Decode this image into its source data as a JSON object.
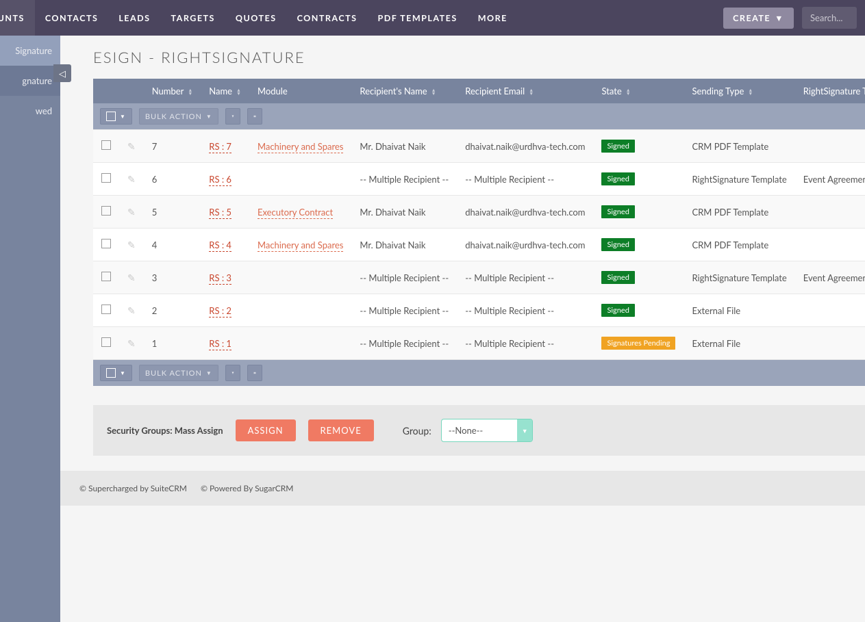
{
  "nav": {
    "items": [
      "OUNTS",
      "CONTACTS",
      "LEADS",
      "TARGETS",
      "QUOTES",
      "CONTRACTS",
      "PDF TEMPLATES",
      "MORE"
    ],
    "create": "CREATE",
    "search_placeholder": "Search..."
  },
  "sidebar": {
    "items": [
      "Signature",
      "gnature",
      "wed"
    ]
  },
  "collapse_glyph": "◁",
  "title": "ESIGN - RIGHTSIGNATURE",
  "columns": [
    "Number",
    "Name",
    "Module",
    "Recipient's Name",
    "Recipient Email",
    "State",
    "Sending Type",
    "RightSignature Templates"
  ],
  "bulk_label": "BULK ACTION",
  "rows": [
    {
      "number": "7",
      "name": "RS : 7",
      "module": "Machinery and Spares",
      "recipient": "Mr. Dhaivat Naik",
      "email": "dhaivat.naik@urdhva-tech.com",
      "state": "Signed",
      "state_cls": "green",
      "sending": "CRM PDF Template",
      "tmpl": ""
    },
    {
      "number": "6",
      "name": "RS : 6",
      "module": "",
      "recipient": "-- Multiple Recipient --",
      "email": "-- Multiple Recipient --",
      "state": "Signed",
      "state_cls": "green",
      "sending": "RightSignature Template",
      "tmpl": "Event Agreement"
    },
    {
      "number": "5",
      "name": "RS : 5",
      "module": "Executory Contract",
      "recipient": "Mr. Dhaivat Naik",
      "email": "dhaivat.naik@urdhva-tech.com",
      "state": "Signed",
      "state_cls": "green",
      "sending": "CRM PDF Template",
      "tmpl": ""
    },
    {
      "number": "4",
      "name": "RS : 4",
      "module": "Machinery and Spares",
      "recipient": "Mr. Dhaivat Naik",
      "email": "dhaivat.naik@urdhva-tech.com",
      "state": "Signed",
      "state_cls": "green",
      "sending": "CRM PDF Template",
      "tmpl": ""
    },
    {
      "number": "3",
      "name": "RS : 3",
      "module": "",
      "recipient": "-- Multiple Recipient --",
      "email": "-- Multiple Recipient --",
      "state": "Signed",
      "state_cls": "green",
      "sending": "RightSignature Template",
      "tmpl": "Event Agreement"
    },
    {
      "number": "2",
      "name": "RS : 2",
      "module": "",
      "recipient": "-- Multiple Recipient --",
      "email": "-- Multiple Recipient --",
      "state": "Signed",
      "state_cls": "green",
      "sending": "External File",
      "tmpl": ""
    },
    {
      "number": "1",
      "name": "RS : 1",
      "module": "",
      "recipient": "-- Multiple Recipient --",
      "email": "-- Multiple Recipient --",
      "state": "Signatures Pending",
      "state_cls": "orange",
      "sending": "External File",
      "tmpl": ""
    }
  ],
  "mass": {
    "label": "Security Groups: Mass Assign",
    "assign": "ASSIGN",
    "remove": "REMOVE",
    "group_lbl": "Group:",
    "selected": "--None--"
  },
  "footer": {
    "left": "© Supercharged by SuiteCRM",
    "right": "© Powered By SugarCRM"
  }
}
